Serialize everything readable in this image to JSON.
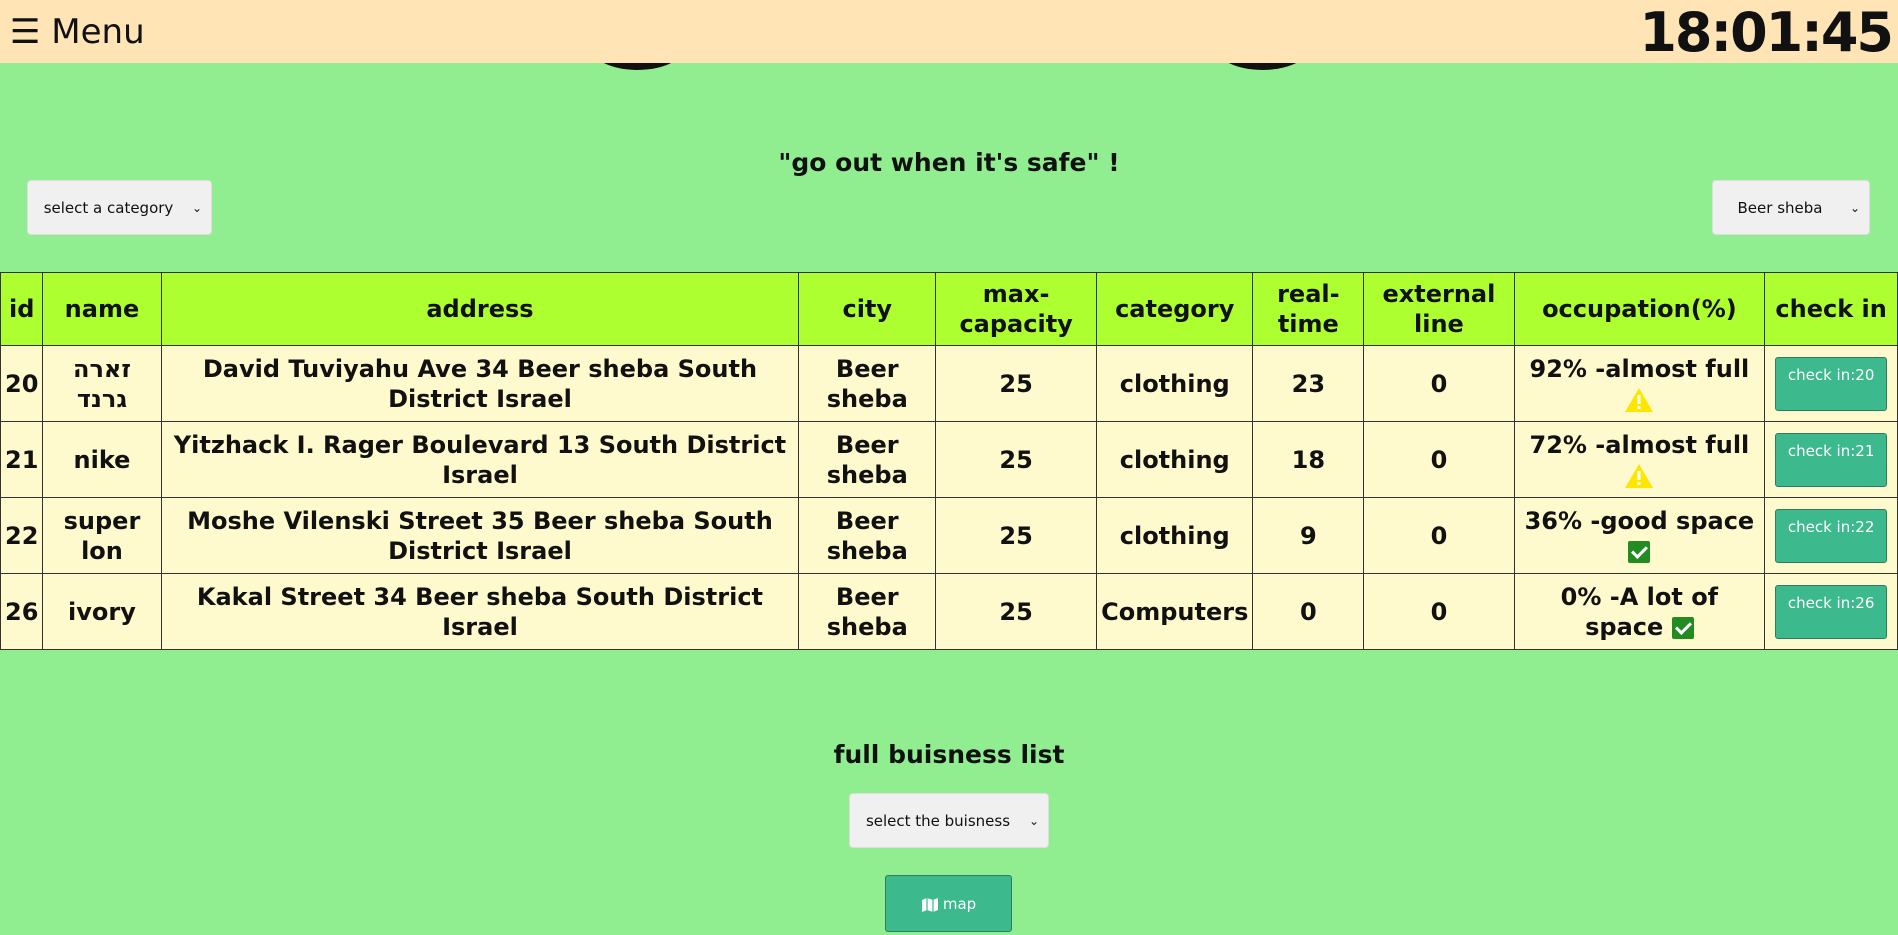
{
  "header": {
    "menu_icon": "☰",
    "menu_label": "Menu",
    "clock": "18:01:45"
  },
  "slogan": "\"go out when it's safe\" !",
  "filters": {
    "category_select": "select a category",
    "city_select": "Beer sheba"
  },
  "table": {
    "columns": [
      "id",
      "name",
      "address",
      "city",
      "max-capacity",
      "category",
      "real-time",
      "external line",
      "occupation(%)",
      "check in"
    ],
    "rows": [
      {
        "id": "20",
        "name": "זארה גרנד",
        "address": "David Tuviyahu Ave 34 Beer sheba South District Israel",
        "city": "Beer sheba",
        "max_capacity": "25",
        "category": "clothing",
        "real_time": "23",
        "external_line": "0",
        "occupation": "92% -almost full",
        "status_icon": "warning-icon",
        "check_in": "check in:20"
      },
      {
        "id": "21",
        "name": "nike",
        "address": "Yitzhack I. Rager Boulevard 13 South District Israel",
        "city": "Beer sheba",
        "max_capacity": "25",
        "category": "clothing",
        "real_time": "18",
        "external_line": "0",
        "occupation": "72% -almost full",
        "status_icon": "warning-icon",
        "check_in": "check in:21"
      },
      {
        "id": "22",
        "name": "super lon",
        "address": "Moshe Vilenski Street 35 Beer sheba South District Israel",
        "city": "Beer sheba",
        "max_capacity": "25",
        "category": "clothing",
        "real_time": "9",
        "external_line": "0",
        "occupation": "36% -good space",
        "status_icon": "checkmark-icon",
        "check_in": "check in:22"
      },
      {
        "id": "26",
        "name": "ivory",
        "address": "Kakal Street 34 Beer sheba South District Israel",
        "city": "Beer sheba",
        "max_capacity": "25",
        "category": "Computers",
        "real_time": "0",
        "external_line": "0",
        "occupation": "0% -A lot of space",
        "status_icon": "checkmark-icon",
        "check_in": "check in:26"
      }
    ]
  },
  "full_list": {
    "title": "full buisness list",
    "select": "select the buisness",
    "map_button": "map",
    "map_icon": "map-icon"
  },
  "colors": {
    "background": "#90ee90",
    "topbar": "#ffe4b5",
    "table_header": "#adff2f",
    "table_row": "#fffacd",
    "button": "#3cb98d",
    "warning": "#ffe600",
    "ok": "#228b22"
  }
}
